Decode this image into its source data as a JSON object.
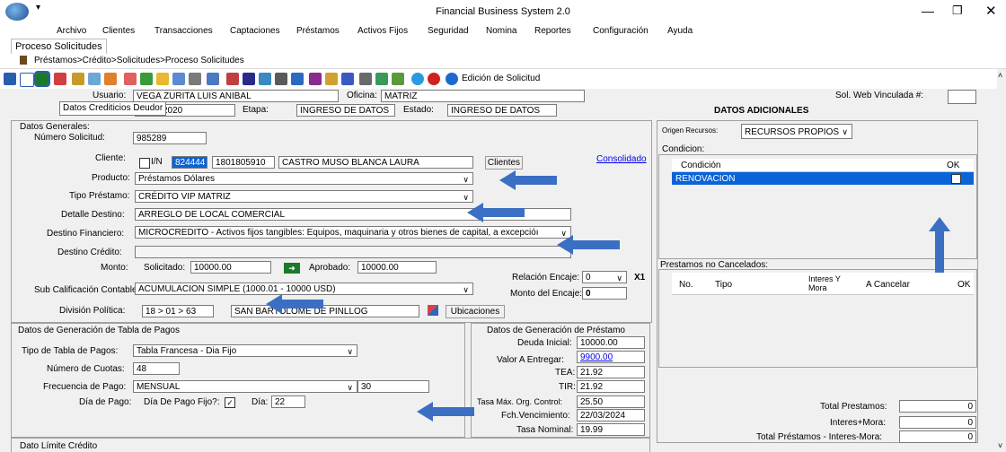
{
  "window": {
    "title": "Financial Business System 2.0",
    "app_icon": "logo-icon"
  },
  "menu": [
    "Archivo",
    "Clientes",
    "Transacciones",
    "Captaciones",
    "Préstamos",
    "Activos Fijos",
    "Seguridad",
    "Nomina",
    "Reportes",
    "Configuración",
    "Ayuda"
  ],
  "tab": "Proceso Solicitudes",
  "breadcrumb": "Préstamos>Crédito>Solicitudes>Proceso Solicitudes",
  "toolbar": {
    "edit_label": "Edición de Solicitud",
    "tooltip": "Datos Crediticios Deudor"
  },
  "header": {
    "usuario_label": "Usuario:",
    "usuario_value": "VEGA ZURITA LUIS ANIBAL",
    "oficina_label": "Oficina:",
    "oficina_value": "MATRIZ",
    "fecha_value": "2020",
    "etapa_label": "Etapa:",
    "etapa_value": "INGRESO DE DATOS",
    "estado_label": "Estado:",
    "estado_value": "INGRESO DE DATOS",
    "solweb_label": "Sol. Web Vinculada #:",
    "solweb_value": ""
  },
  "datos_generales": {
    "title": "Datos Generales:",
    "numero_label": "Número Solicitud:",
    "numero_value": "985289",
    "cliente_label": "Cliente:",
    "iin_label": "I/N",
    "cliente_code": "824444",
    "cliente_id": "1801805910",
    "cliente_name": "CASTRO MUSO BLANCA LAURA",
    "clientes_button": "Clientes",
    "consolidado_link": "Consolidado",
    "producto_label": "Producto:",
    "producto_value": "Préstamos Dólares",
    "tipo_label": "Tipo Préstamo:",
    "tipo_value": "CRÉDITO VIP MATRIZ",
    "detalle_label": "Detalle Destino:",
    "detalle_value": "ARREGLO DE LOCAL COMERCIAL",
    "destfin_label": "Destino Financiero:",
    "destfin_value": "MICROCREDITO - Activos fijos tangibles: Equipos, maquinaria y otros bienes de capital, a excepcióı",
    "destcred_label": "Destino Crédito:",
    "destcred_value": "",
    "monto_label": "Monto:",
    "solicitado_label": "Solicitado:",
    "solicitado_value": "10000.00",
    "aprobado_label": "Aprobado:",
    "aprobado_value": "10000.00",
    "relacion_label": "Relación Encaje:",
    "relacion_value": "0",
    "x1": "X1",
    "subcal_label": "Sub Calificación Contable:",
    "subcal_value": "ACUMULACION SIMPLE (1000.01 - 10000 USD)",
    "monto_encaje_label": "Monto del Encaje:",
    "monto_encaje_value": "0",
    "division_label": "División Política:",
    "division_value": "18 > 01 > 63",
    "division_name": "SAN BARTOLOME DE PINLLOG",
    "ubicaciones_button": "Ubicaciones"
  },
  "tabla_pagos": {
    "title": "Datos de Generación de Tabla de Pagos",
    "tipo_label": "Tipo de Tabla de Pagos:",
    "tipo_value": "Tabla Francesa - Dia Fijo",
    "cuotas_label": "Número de Cuotas:",
    "cuotas_value": "48",
    "frecuencia_label": "Frecuencia de Pago:",
    "frecuencia_value": "MENSUAL",
    "frecuencia_dias": "30",
    "dia_pago_label": "Día de Pago:",
    "dia_fijo_label": "Día De Pago Fijo?:",
    "dia_label": "Día:",
    "dia_value": "22"
  },
  "gen_prestamo": {
    "title": "Datos de Generación de Préstamo",
    "deuda_label": "Deuda Inicial:",
    "deuda_value": "10000.00",
    "valor_label": "Valor A Entregar:",
    "valor_value": "9900.00",
    "tea_label": "TEA:",
    "tea_value": "21.92",
    "tir_label": "TIR:",
    "tir_value": "21.92",
    "tasamax_label": "Tasa Máx. Org. Control:",
    "tasamax_value": "25.50",
    "fchvenc_label": "Fch.Vencimiento:",
    "fchvenc_value": "22/03/2024",
    "tasanom_label": "Tasa Nominal:",
    "tasanom_value": "19.99"
  },
  "datos_adicionales": {
    "title": "DATOS ADICIONALES",
    "origen_label": "Origen Recursos:",
    "origen_value": "RECURSOS PROPIOS",
    "condicion_label": "Condicion:",
    "cond_col1": "Condición",
    "cond_col2": "OK",
    "cond_row": "RENOVACION",
    "prestamos_label": "Prestamos no Cancelados:",
    "cols": [
      "No.",
      "Tipo",
      "Interes Y Mora",
      "A Cancelar",
      "OK"
    ],
    "total_label": "Total Prestamos:",
    "total_value": "0",
    "intmora_label": "Interes+Mora:",
    "intmora_value": "0",
    "totalneto_label": "Total Préstamos - Interes-Mora:",
    "totalneto_value": "0"
  },
  "footer_section": "Dato Límite Crédito",
  "colors": {
    "arrow": "#3a6fc4",
    "selection": "#0a64d7",
    "link": "#0000ee"
  }
}
